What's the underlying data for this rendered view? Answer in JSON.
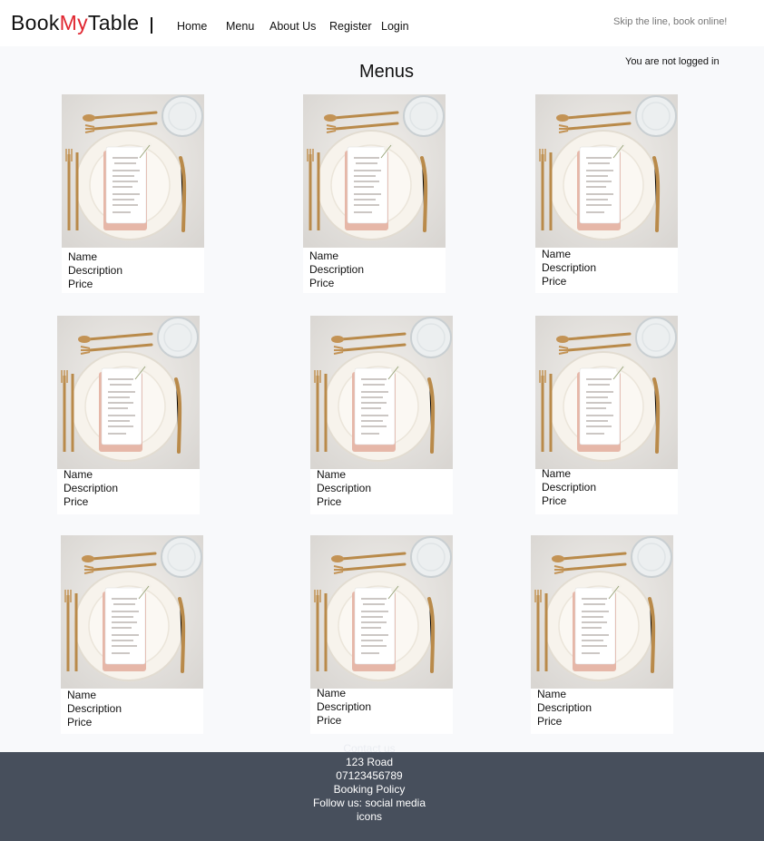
{
  "header": {
    "logo": {
      "part1": "Book",
      "part2": "My",
      "part3": "Table"
    },
    "nav": [
      "Home",
      "Menu",
      "About Us",
      "Register",
      "Login"
    ],
    "tagline": "Skip the line, book online!",
    "login_status": "You are not logged in"
  },
  "main": {
    "title": "Menus",
    "cards": [
      {
        "name": "Name",
        "description": "Description",
        "price": "Price"
      },
      {
        "name": "Name",
        "description": "Description",
        "price": "Price"
      },
      {
        "name": "Name",
        "description": "Description",
        "price": "Price"
      },
      {
        "name": "Name",
        "description": "Description",
        "price": "Price"
      },
      {
        "name": "Name",
        "description": "Description",
        "price": "Price"
      },
      {
        "name": "Name",
        "description": "Description",
        "price": "Price"
      },
      {
        "name": "Name",
        "description": "Description",
        "price": "Price"
      },
      {
        "name": "Name",
        "description": "Description",
        "price": "Price"
      },
      {
        "name": "Name",
        "description": "Description",
        "price": "Price"
      }
    ]
  },
  "footer": {
    "hidden_heading": "Contact us",
    "address": "123 Road",
    "phone": "07123456789",
    "policy": "Booking Policy",
    "follow_line1": "Follow us: social media",
    "follow_line2": "icons"
  },
  "colors": {
    "brand_accent": "#e0252f",
    "footer_bg": "#474f5c",
    "page_bg": "#f8f9fb"
  }
}
